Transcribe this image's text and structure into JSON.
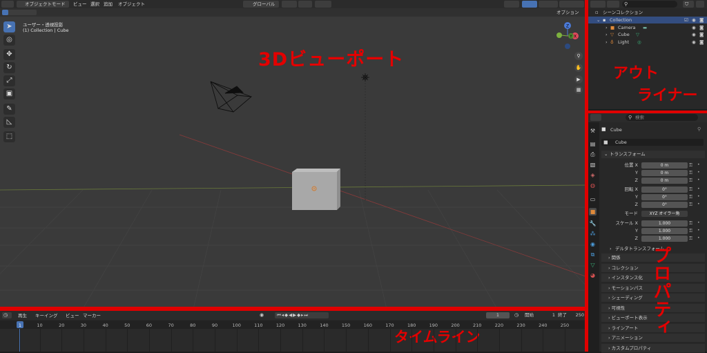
{
  "viewport": {
    "header": {
      "mode": "オブジェクトモード",
      "menus": [
        "ビュー",
        "選択",
        "追加",
        "オブジェクト"
      ],
      "transform_orientation": "グローバル",
      "options": "オプション"
    },
    "overlay_view": "ユーザー・透視投影",
    "overlay_collection": "(1) Collection | Cube",
    "gizmo_axes": [
      "Z",
      "Y",
      "X"
    ],
    "annotation": "3Dビューポート"
  },
  "outliner": {
    "search_placeholder": "",
    "scene_collection": "シーンコレクション",
    "collection": "Collection",
    "items": [
      "Camera",
      "Cube",
      "Light"
    ],
    "annotation_line1": "アウト",
    "annotation_line2": "ライナー"
  },
  "properties": {
    "search_placeholder": "検索",
    "object_name": "Cube",
    "object_name_field": "Cube",
    "transform_section": "トランスフォーム",
    "location_label": "位置 X",
    "rotation_label": "回転 X",
    "scale_label": "スケール X",
    "axis_y": "Y",
    "axis_z": "Z",
    "location": [
      "0 m",
      "0 m",
      "0 m"
    ],
    "rotation": [
      "0°",
      "0°",
      "0°"
    ],
    "mode_label": "モード",
    "mode_value": "XYZ オイラー角",
    "scale": [
      "1.000",
      "1.000",
      "1.000"
    ],
    "delta_transform": "デルタトランスフォーム",
    "sections": [
      "関係",
      "コレクション",
      "インスタンス化",
      "モーションパス",
      "シェーディング",
      "可視性",
      "ビューポート表示",
      "ラインアート",
      "アニメーション",
      "カスタムプロパティ"
    ],
    "annotation": "プロパティ"
  },
  "timeline": {
    "menus": [
      "再生",
      "キーイング",
      "ビュー",
      "マーカー"
    ],
    "current_frame": "1",
    "start_label": "開始",
    "start_value": "1",
    "end_label": "終了",
    "end_value": "250",
    "ticks": [
      "1",
      "10",
      "20",
      "30",
      "40",
      "50",
      "60",
      "70",
      "80",
      "90",
      "100",
      "110",
      "120",
      "130",
      "140",
      "150",
      "160",
      "170",
      "180",
      "190",
      "200",
      "210",
      "220",
      "230",
      "240",
      "250"
    ],
    "annotation": "タイムライン"
  },
  "colors": {
    "annotation_red": "#e00000",
    "accent_blue": "#4772b3",
    "panel_bg": "#282828",
    "viewport_bg": "#3a3a3a"
  }
}
